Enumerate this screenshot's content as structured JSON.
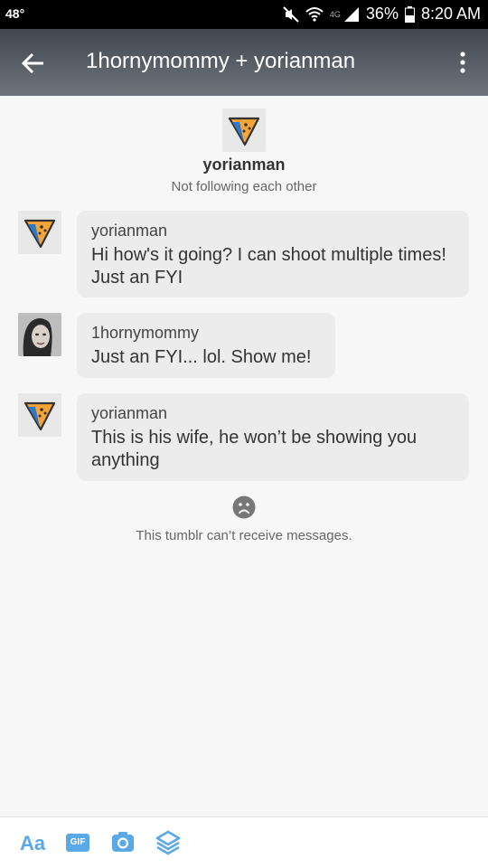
{
  "status_bar": {
    "temperature": "48°",
    "network": "4G",
    "battery": "36%",
    "time": "8:20 AM"
  },
  "header": {
    "title": "1hornymommy + yorianman"
  },
  "intro": {
    "name": "yorianman",
    "relationship": "Not following each other"
  },
  "messages": [
    {
      "sender": "yorianman",
      "text": "Hi how's it going?  I can shoot multiple times! Just an FYI"
    },
    {
      "sender": "1hornymommy",
      "text": "Just an FYI... lol.  Show me!"
    },
    {
      "sender": "yorianman",
      "text": "This is his wife, he won’t be showing you anything"
    }
  ],
  "notice": {
    "text": "This tumblr can’t receive messages."
  },
  "toolbar": {
    "text_label": "Aa",
    "gif_label": "GIF"
  },
  "colors": {
    "accent": "#5aa8e6",
    "header_top": "#3f4650",
    "bubble": "#ececec",
    "avatar_orange": "#f5a43a",
    "avatar_blue": "#2f79c7"
  }
}
